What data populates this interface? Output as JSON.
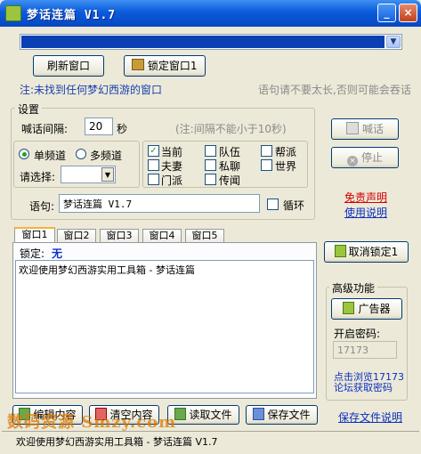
{
  "window": {
    "title": "梦话连篇 V1.7",
    "min_label": "_",
    "close_label": "×"
  },
  "toolbar": {
    "refresh_label": "刷新窗口",
    "lock_label": "锁定窗口1"
  },
  "notice": {
    "status": "注:未找到任何梦幻西游的窗口",
    "hint": "语句请不要太长,否则可能会吞话"
  },
  "settings": {
    "group_label": "设置",
    "interval_label": "喊话间隔:",
    "interval_value": "20",
    "interval_unit": "秒",
    "interval_note": "(注:间隔不能小于10秒)",
    "single_channel": "单频道",
    "multi_channel": "多频道",
    "choose_label": "请选择:",
    "channels": [
      "当前",
      "队伍",
      "帮派",
      "夫妻",
      "私聊",
      "世界",
      "门派",
      "传闻"
    ],
    "phrase_label": "语句:",
    "phrase_value": "梦话连篇 V1.7",
    "loop_label": "循环"
  },
  "side": {
    "shout_label": "喊话",
    "stop_label": "停止",
    "disclaimer": "免责声明",
    "usage": "使用说明"
  },
  "tabs": [
    "窗口1",
    "窗口2",
    "窗口3",
    "窗口4",
    "窗口5"
  ],
  "panel": {
    "lock_label": "锁定:",
    "lock_value": "无",
    "log_text": "欢迎使用梦幻西游实用工具箱 - 梦话连篇"
  },
  "unlock_label": "取消锁定1",
  "advanced": {
    "group_label": "高级功能",
    "ad_label": "广告器",
    "password_label": "开启密码:",
    "password_value": "17173",
    "browse_link": "点击浏览17173论坛获取密码"
  },
  "bottom": {
    "edit_label": "编辑内容",
    "clear_label": "清空内容",
    "read_label": "读取文件",
    "save_label": "保存文件",
    "save_help": "保存文件说明"
  },
  "statusbar": {
    "text": "欢迎使用梦幻西游实用工具箱 - 梦话连篇 V1.7"
  },
  "watermark": {
    "text": "数码资源 Smzy.com"
  },
  "colors": {
    "title_blue": "#0a5bdc",
    "accent_green": "#21a121",
    "link_blue": "#0b2fc0",
    "warning_red": "#d40000"
  }
}
